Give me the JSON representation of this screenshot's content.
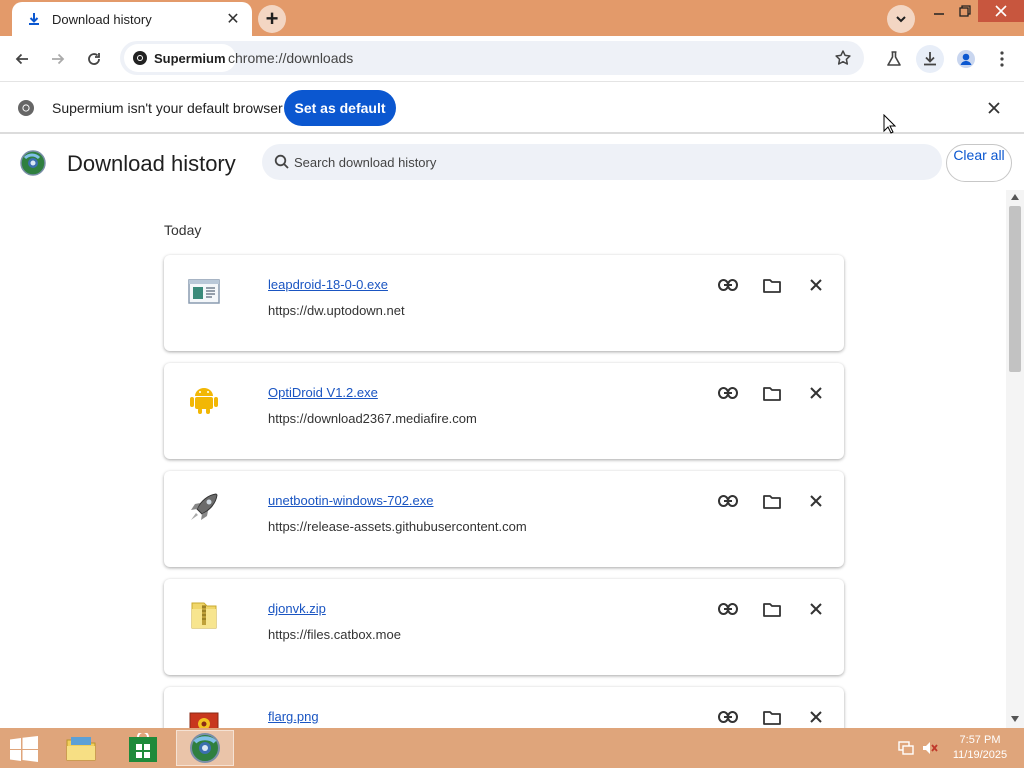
{
  "tab": {
    "title": "Download history",
    "icon": "download-icon"
  },
  "toolbar": {
    "chip_label": "Supermium",
    "url": "chrome://downloads"
  },
  "infobar": {
    "message": "Supermium isn't your default browser",
    "button": "Set as default"
  },
  "downloads": {
    "title": "Download history",
    "search_placeholder": "Search download history",
    "clear_all": "Clear all",
    "section": "Today",
    "items": [
      {
        "name": "leapdroid-18-0-0.exe",
        "url": "https://dw.uptodown.net",
        "icon": "installer-window-icon"
      },
      {
        "name": "OptiDroid V1.2.exe",
        "url": "https://download2367.mediafire.com",
        "icon": "android-icon"
      },
      {
        "name": "unetbootin-windows-702.exe",
        "url": "https://release-assets.githubusercontent.com",
        "icon": "rocket-icon"
      },
      {
        "name": "djonvk.zip",
        "url": "https://files.catbox.moe",
        "icon": "zip-folder-icon"
      },
      {
        "name": "flarg.png",
        "url": "",
        "icon": "image-file-icon"
      }
    ]
  },
  "taskbar": {
    "time": "7:57 PM",
    "date": "11/19/2025"
  },
  "colors": {
    "titlebar": "#e39a6a",
    "accent": "#0b57d0",
    "taskbar": "#dfa57b"
  }
}
